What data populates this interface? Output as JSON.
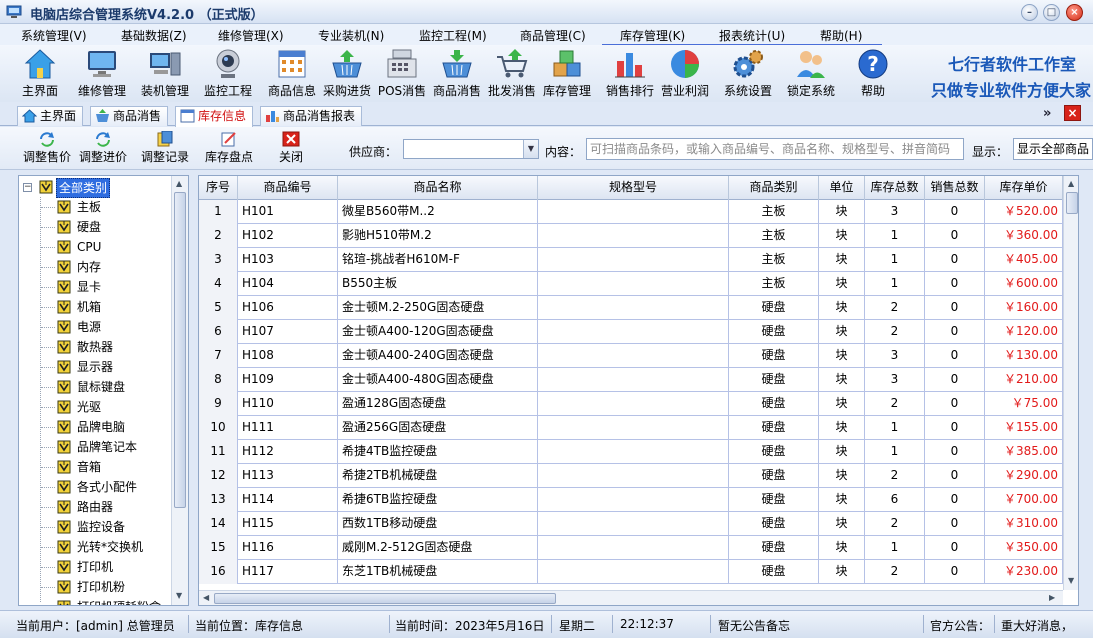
{
  "window": {
    "title": "电脑店综合管理系统V4.2.0 （正式版）"
  },
  "menu": [
    {
      "label": "系统管理(V)"
    },
    {
      "label": "基础数据(Z)"
    },
    {
      "label": "维修管理(X)"
    },
    {
      "label": "专业装机(N)"
    },
    {
      "label": "监控工程(M)"
    },
    {
      "label": "商品管理(C)"
    },
    {
      "label": "库存管理(K)"
    },
    {
      "label": "报表统计(U)"
    },
    {
      "label": "帮助(H)"
    }
  ],
  "toolbar": [
    {
      "label": "主界面",
      "icon": "home-icon"
    },
    {
      "label": "维修管理",
      "icon": "monitor-icon"
    },
    {
      "label": "装机管理",
      "icon": "computer-icon"
    },
    {
      "label": "监控工程",
      "icon": "webcam-icon"
    },
    {
      "label": "商品信息",
      "icon": "calendar-grid-icon"
    },
    {
      "label": "采购进货",
      "icon": "basket-icon"
    },
    {
      "label": "POS消售",
      "icon": "cash-register-icon"
    },
    {
      "label": "商品消售",
      "icon": "sales-basket-icon"
    },
    {
      "label": "批发消售",
      "icon": "cart-icon"
    },
    {
      "label": "库存管理",
      "icon": "boxes-icon"
    },
    {
      "label": "销售排行",
      "icon": "bar-chart-icon"
    },
    {
      "label": "营业利润",
      "icon": "pie-chart-icon"
    },
    {
      "label": "系统设置",
      "icon": "gears-icon"
    },
    {
      "label": "锁定系统",
      "icon": "users-icon"
    },
    {
      "label": "帮助",
      "icon": "help-icon"
    }
  ],
  "brand": {
    "line1": "七行者软件工作室",
    "line2": "只做专业软件方便大家"
  },
  "tabs": [
    {
      "label": "主界面",
      "active": false
    },
    {
      "label": "商品消售",
      "active": false
    },
    {
      "label": "库存信息",
      "active": true
    },
    {
      "label": "商品消售报表",
      "active": false
    }
  ],
  "subbar": {
    "buttons": [
      {
        "label": "调整售价"
      },
      {
        "label": "调整进价"
      },
      {
        "label": "调整记录"
      },
      {
        "label": "库存盘点"
      },
      {
        "label": "关闭"
      }
    ],
    "supplier_label": "供应商：",
    "supplier_value": "",
    "content_label": "内容：",
    "search_placeholder": "可扫描商品条码，或输入商品编号、商品名称、规格型号、拼音简码",
    "display_label": "显示：",
    "display_value": "显示全部商品"
  },
  "tree": {
    "root": "全部类别",
    "items": [
      "主板",
      "硬盘",
      "CPU",
      "内存",
      "显卡",
      "机箱",
      "电源",
      "散热器",
      "显示器",
      "鼠标键盘",
      "光驱",
      "品牌电脑",
      "品牌笔记本",
      "音箱",
      "各式小配件",
      "路由器",
      "监控设备",
      "光转*交换机",
      "打印机",
      "打印机粉",
      "打印机硬耗粉盒"
    ]
  },
  "grid": {
    "columns": [
      "序号",
      "商品编号",
      "商品名称",
      "规格型号",
      "商品类别",
      "单位",
      "库存总数",
      "销售总数",
      "库存单价"
    ],
    "rows": [
      {
        "idx": "1",
        "code": "H101",
        "name": "微星B560带M..2",
        "spec": "",
        "category": "主板",
        "unit": "块",
        "stock": "3",
        "sold": "0",
        "price": "￥520.00"
      },
      {
        "idx": "2",
        "code": "H102",
        "name": "影驰H510带M.2",
        "spec": "",
        "category": "主板",
        "unit": "块",
        "stock": "1",
        "sold": "0",
        "price": "￥360.00"
      },
      {
        "idx": "3",
        "code": "H103",
        "name": "铭瑄-挑战者H610M-F",
        "spec": "",
        "category": "主板",
        "unit": "块",
        "stock": "1",
        "sold": "0",
        "price": "￥405.00"
      },
      {
        "idx": "4",
        "code": "H104",
        "name": "B550主板",
        "spec": "",
        "category": "主板",
        "unit": "块",
        "stock": "1",
        "sold": "0",
        "price": "￥600.00"
      },
      {
        "idx": "5",
        "code": "H106",
        "name": "金士顿M.2-250G固态硬盘",
        "spec": "",
        "category": "硬盘",
        "unit": "块",
        "stock": "2",
        "sold": "0",
        "price": "￥160.00"
      },
      {
        "idx": "6",
        "code": "H107",
        "name": "金士顿A400-120G固态硬盘",
        "spec": "",
        "category": "硬盘",
        "unit": "块",
        "stock": "2",
        "sold": "0",
        "price": "￥120.00"
      },
      {
        "idx": "7",
        "code": "H108",
        "name": "金士顿A400-240G固态硬盘",
        "spec": "",
        "category": "硬盘",
        "unit": "块",
        "stock": "3",
        "sold": "0",
        "price": "￥130.00"
      },
      {
        "idx": "8",
        "code": "H109",
        "name": "金士顿A400-480G固态硬盘",
        "spec": "",
        "category": "硬盘",
        "unit": "块",
        "stock": "3",
        "sold": "0",
        "price": "￥210.00"
      },
      {
        "idx": "9",
        "code": "H110",
        "name": "盈通128G固态硬盘",
        "spec": "",
        "category": "硬盘",
        "unit": "块",
        "stock": "2",
        "sold": "0",
        "price": "￥75.00"
      },
      {
        "idx": "10",
        "code": "H111",
        "name": "盈通256G固态硬盘",
        "spec": "",
        "category": "硬盘",
        "unit": "块",
        "stock": "1",
        "sold": "0",
        "price": "￥155.00"
      },
      {
        "idx": "11",
        "code": "H112",
        "name": "希捷4TB监控硬盘",
        "spec": "",
        "category": "硬盘",
        "unit": "块",
        "stock": "1",
        "sold": "0",
        "price": "￥385.00"
      },
      {
        "idx": "12",
        "code": "H113",
        "name": "希捷2TB机械硬盘",
        "spec": "",
        "category": "硬盘",
        "unit": "块",
        "stock": "2",
        "sold": "0",
        "price": "￥290.00"
      },
      {
        "idx": "13",
        "code": "H114",
        "name": "希捷6TB监控硬盘",
        "spec": "",
        "category": "硬盘",
        "unit": "块",
        "stock": "6",
        "sold": "0",
        "price": "￥700.00"
      },
      {
        "idx": "14",
        "code": "H115",
        "name": "西数1TB移动硬盘",
        "spec": "",
        "category": "硬盘",
        "unit": "块",
        "stock": "2",
        "sold": "0",
        "price": "￥310.00"
      },
      {
        "idx": "15",
        "code": "H116",
        "name": "威刚M.2-512G固态硬盘",
        "spec": "",
        "category": "硬盘",
        "unit": "块",
        "stock": "1",
        "sold": "0",
        "price": "￥350.00"
      },
      {
        "idx": "16",
        "code": "H117",
        "name": "东芝1TB机械硬盘",
        "spec": "",
        "category": "硬盘",
        "unit": "块",
        "stock": "2",
        "sold": "0",
        "price": "￥230.00"
      }
    ]
  },
  "status": {
    "user": "当前用户：[admin] 总管理员",
    "location": "当前位置：库存信息",
    "time_label": "当前时间：2023年5月16日",
    "weekday": "星期二",
    "clock": "22:12:37",
    "memo": "暂无公告备忘",
    "notice_label": "官方公告：",
    "notice": "重大好消息，"
  },
  "colors": {
    "accent": "#1a58b8",
    "price": "#e21a1a",
    "active_tab": "#d01010"
  }
}
